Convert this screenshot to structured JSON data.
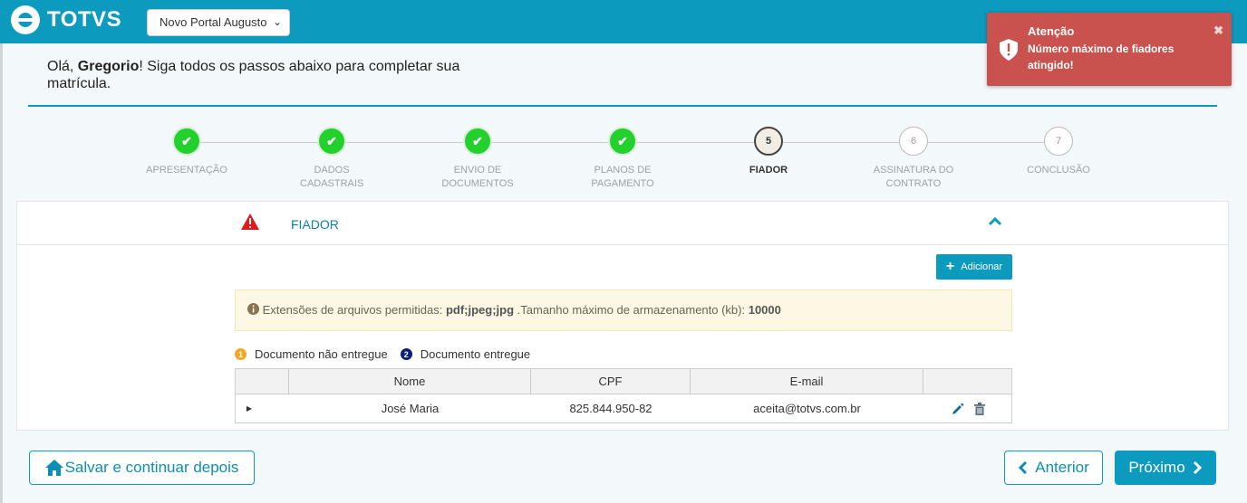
{
  "app": {
    "brand": "TOTVS",
    "portal_selected": "Novo Portal Augusto"
  },
  "greeting": {
    "prefix": "Olá, ",
    "user": "Gregorio",
    "suffix": "! Siga todos os passos abaixo para completar sua matrícula."
  },
  "steps": [
    {
      "number": "1",
      "label": "APRESENTAÇÃO",
      "status": "done"
    },
    {
      "number": "2",
      "label": "DADOS CADASTRAIS",
      "status": "done"
    },
    {
      "number": "3",
      "label": "ENVIO DE DOCUMENTOS",
      "status": "done"
    },
    {
      "number": "4",
      "label": "PLANOS DE PAGAMENTO",
      "status": "done"
    },
    {
      "number": "5",
      "label": "FIADOR",
      "status": "active"
    },
    {
      "number": "6",
      "label": "ASSINATURA DO CONTRATO",
      "status": "todo"
    },
    {
      "number": "7",
      "label": "CONCLUSÃO",
      "status": "todo"
    }
  ],
  "section": {
    "title": "FIADOR",
    "add_button": "Adicionar",
    "info": {
      "ext_label": "Extensões de arquivos permitidas: ",
      "ext_value": "pdf;jpeg;jpg",
      "size_label": " .Tamanho máximo de armazenamento (kb): ",
      "size_value": "10000"
    },
    "legend": [
      {
        "badge": "1",
        "label": "Documento não entregue",
        "color": "#f5a623"
      },
      {
        "badge": "2",
        "label": "Documento entregue",
        "color": "#0a1f7a"
      }
    ],
    "table": {
      "columns": [
        "Nome",
        "CPF",
        "E-mail"
      ],
      "rows": [
        {
          "nome": "José Maria",
          "cpf": "825.844.950-82",
          "email": "aceita@totvs.com.br"
        }
      ]
    }
  },
  "buttons": {
    "save": "Salvar e continuar depois",
    "prev": "Anterior",
    "next": "Próximo"
  },
  "toast": {
    "title": "Atenção",
    "message": "Número máximo de fiadores atingido!"
  },
  "colors": {
    "primary": "#0c9abe",
    "success": "#23d12e",
    "danger": "#c9524e",
    "warning_bg": "#fcf8e3"
  }
}
